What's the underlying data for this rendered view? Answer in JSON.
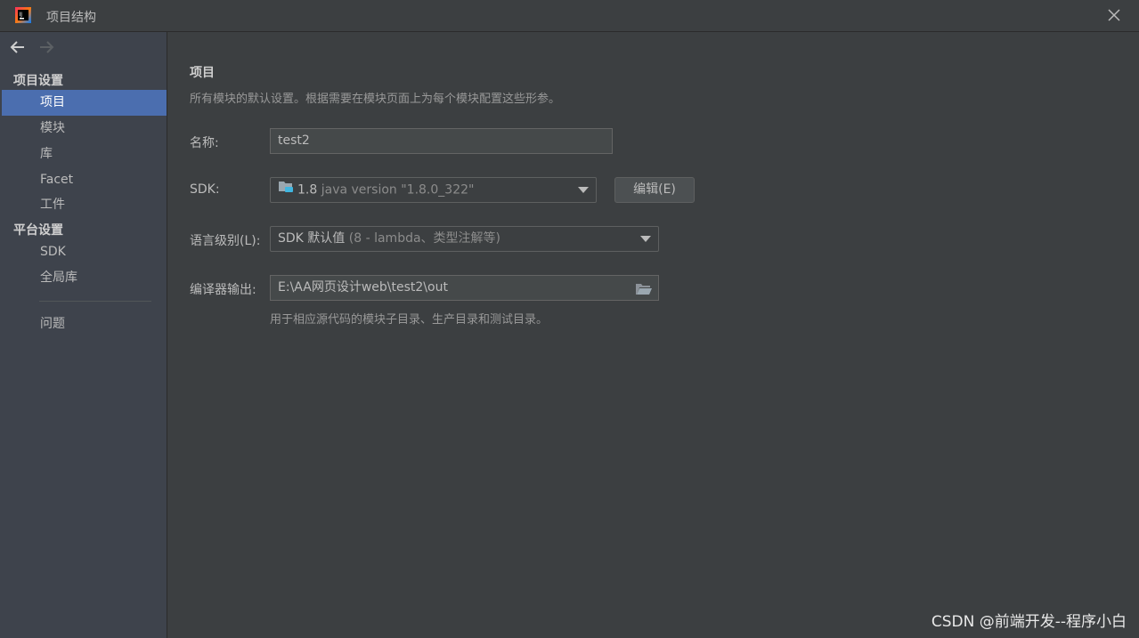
{
  "window": {
    "title": "项目结构"
  },
  "sidebar": {
    "groups": [
      {
        "title": "项目设置",
        "items": [
          "项目",
          "模块",
          "库",
          "Facet",
          "工件"
        ]
      },
      {
        "title": "平台设置",
        "items": [
          "SDK",
          "全局库"
        ]
      }
    ],
    "extra_items": [
      "问题"
    ],
    "selected": "项目"
  },
  "main": {
    "title": "项目",
    "description": "所有模块的默认设置。根据需要在模块页面上为每个模块配置这些形参。",
    "name_label": "名称:",
    "name_value": "test2",
    "sdk_label": "SDK:",
    "sdk_version": "1.8",
    "sdk_detail": "java version \"1.8.0_322\"",
    "edit_button": "编辑(E)",
    "lang_label": "语言级别(L):",
    "lang_value": "SDK 默认值",
    "lang_detail": "(8 - lambda、类型注解等)",
    "output_label": "编译器输出:",
    "output_value": "E:\\AA网页设计web\\test2\\out",
    "output_hint": "用于相应源代码的模块子目录、生产目录和测试目录。"
  },
  "watermark": "CSDN @前端开发--程序小白",
  "colors": {
    "selected": "#4b6eaf",
    "background": "#3c3f41",
    "sidebar": "#3e434c"
  }
}
